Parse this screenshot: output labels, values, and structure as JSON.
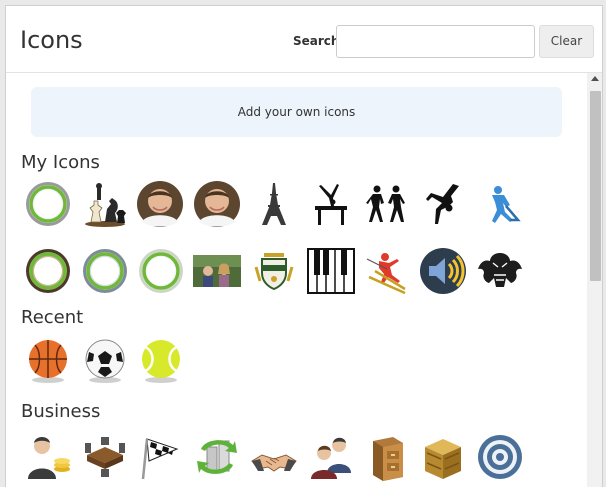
{
  "header": {
    "title": "Icons",
    "search_label": "Search",
    "search_value": "",
    "search_placeholder": "",
    "clear_label": "Clear"
  },
  "add_own_label": "Add your own icons",
  "sections": {
    "my_icons": {
      "title": "My Icons",
      "icons": [
        "green-ring-icon",
        "chess-icon",
        "portrait-icon",
        "portrait-icon",
        "eiffel-tower-icon",
        "gymnast-icon",
        "dancers-icon",
        "breakdancer-icon",
        "hockey-player-icon",
        "green-ring-icon",
        "green-ring-icon",
        "green-ring-icon",
        "family-photo-icon",
        "coat-of-arms-icon",
        "piano-keys-icon",
        "skier-icon",
        "speaker-icon",
        "tribal-bat-icon"
      ]
    },
    "recent": {
      "title": "Recent",
      "icons": [
        "basketball-icon",
        "soccer-ball-icon",
        "tennis-ball-icon"
      ]
    },
    "business": {
      "title": "Business",
      "icons": [
        "businessman-coins-icon",
        "meeting-table-icon",
        "checkered-flag-icon",
        "exchange-arrows-icon",
        "handshake-icon",
        "users-icon",
        "file-cabinet-icon",
        "wooden-crate-icon",
        "target-icon"
      ]
    }
  },
  "colors": {
    "add_box_bg": "#eef4fb",
    "ring_green": "#6fb83a"
  }
}
